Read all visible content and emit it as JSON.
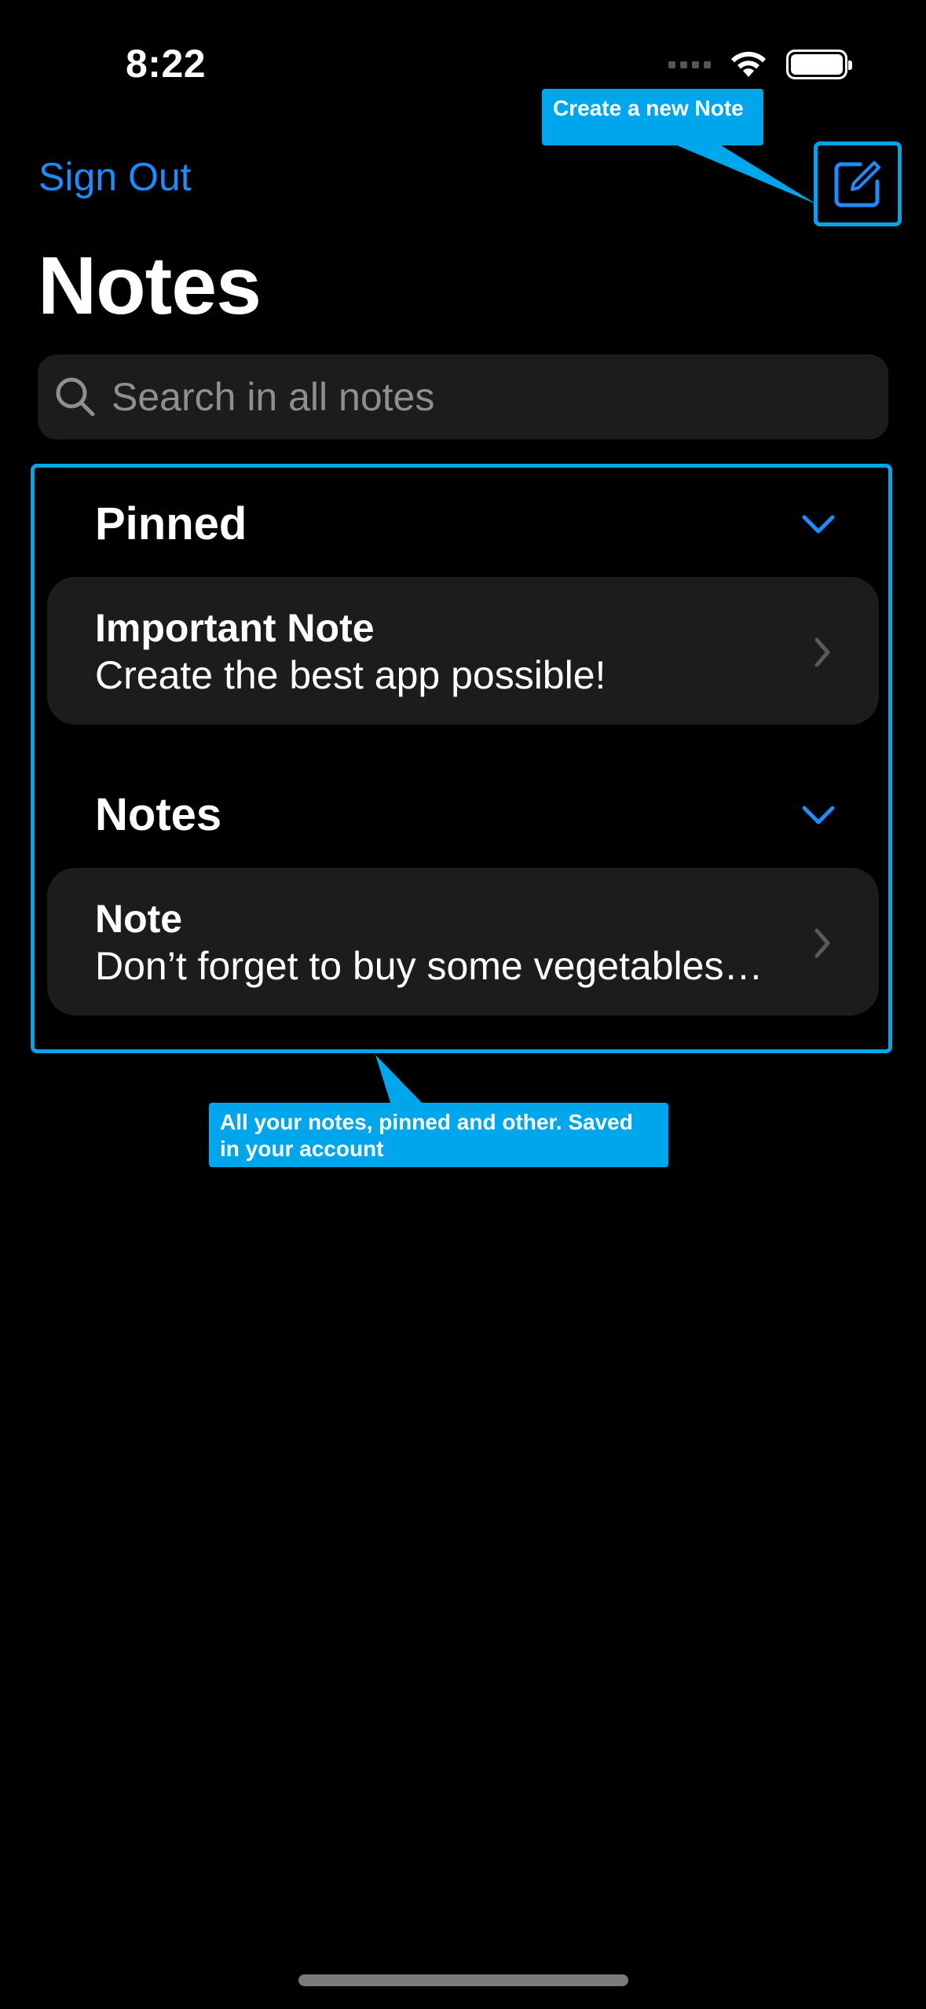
{
  "status_bar": {
    "time": "8:22"
  },
  "nav": {
    "sign_out_label": "Sign Out"
  },
  "page": {
    "title": "Notes"
  },
  "search": {
    "placeholder": "Search in all notes"
  },
  "sections": [
    {
      "header": "Pinned",
      "notes": [
        {
          "title": "Important Note",
          "body": "Create the best app possible!"
        }
      ]
    },
    {
      "header": "Notes",
      "notes": [
        {
          "title": "Note",
          "body": "Don’t forget to buy some vegetables…"
        }
      ]
    }
  ],
  "tooltips": {
    "compose": "Create a new Note",
    "notes_list": "All your notes, pinned and other. Saved in your account"
  },
  "colors": {
    "accent": "#1e8bff",
    "highlight": "#00a6ec",
    "card": "#1c1c1e",
    "background": "#000000"
  }
}
